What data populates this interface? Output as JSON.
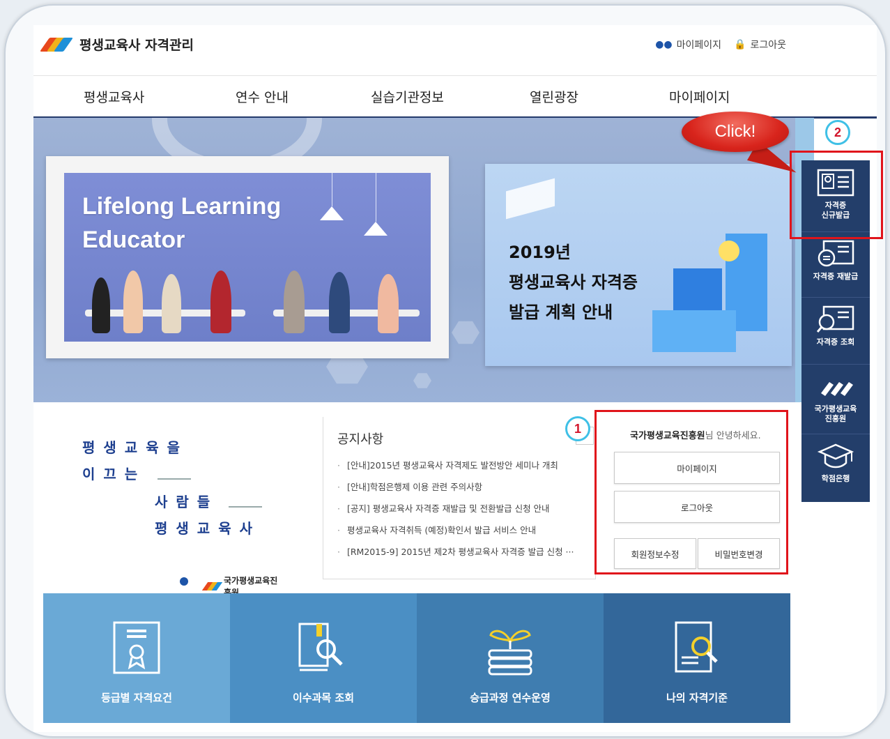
{
  "header": {
    "site_title": "평생교육사 자격관리",
    "util": {
      "mypage": "마이페이지",
      "logout": "로그아웃"
    }
  },
  "nav": [
    "평생교육사",
    "연수 안내",
    "실습기관정보",
    "열린광장",
    "마이페이지"
  ],
  "hero": {
    "title_line1": "Lifelong Learning",
    "title_line2": "Educator",
    "notice_card": "2019년\n평생교육사 자격증\n발급 계획 안내"
  },
  "slogan": {
    "line1": "평생교육을",
    "line2": "이끄는",
    "line3": "사람들",
    "line4": "평생교육사",
    "org": "국가평생교육진흥원"
  },
  "notice": {
    "title": "공지사항",
    "items": [
      "[안내]2015년 평생교육사 자격제도 발전방안 세미나 개최",
      "[안내]학점은행제 이용 관련 주의사항",
      "[공지] 평생교육사 자격증 재발급 및 전환발급 신청 안내",
      "평생교육사 자격취득 (예정)확인서 발급 서비스 안내",
      "[RM2015-9] 2015년 제2차 평생교육사 자격증 발급 신청 ···"
    ]
  },
  "login": {
    "org": "국가평생교육진흥원",
    "greet_suffix": "님 안녕하세요.",
    "mypage": "마이페이지",
    "logout": "로그아웃",
    "edit_info": "회원정보수정",
    "change_pw": "비밀번호변경"
  },
  "quick_links": [
    {
      "label": "등급별 자격요건",
      "icon": "certificate-icon",
      "color": "#6aa9d6"
    },
    {
      "label": "이수과목 조회",
      "icon": "book-search-icon",
      "color": "#4b8fc4"
    },
    {
      "label": "승급과정 연수운영",
      "icon": "sprout-books-icon",
      "color": "#3f7db0"
    },
    {
      "label": "나의 자격기준",
      "icon": "document-search-icon",
      "color": "#33679a"
    }
  ],
  "right_sidebar": [
    {
      "label": "자격증\n신규발급",
      "icon": "id-card-icon"
    },
    {
      "label": "자격증 재발급",
      "icon": "id-card-refresh-icon"
    },
    {
      "label": "자격증 조회",
      "icon": "id-card-search-icon"
    },
    {
      "label": "국가평생교육\n진흥원",
      "icon": "nile-logo-icon"
    },
    {
      "label": "학점은행",
      "icon": "graduation-cap-icon"
    }
  ],
  "annotations": {
    "callout": "Click!",
    "step1": "1",
    "step2": "2"
  },
  "colors": {
    "accent_red": "#e0141b",
    "nav_border": "#243a6b",
    "sidebar": "#233e6a",
    "badge_ring": "#3fc0e6"
  }
}
